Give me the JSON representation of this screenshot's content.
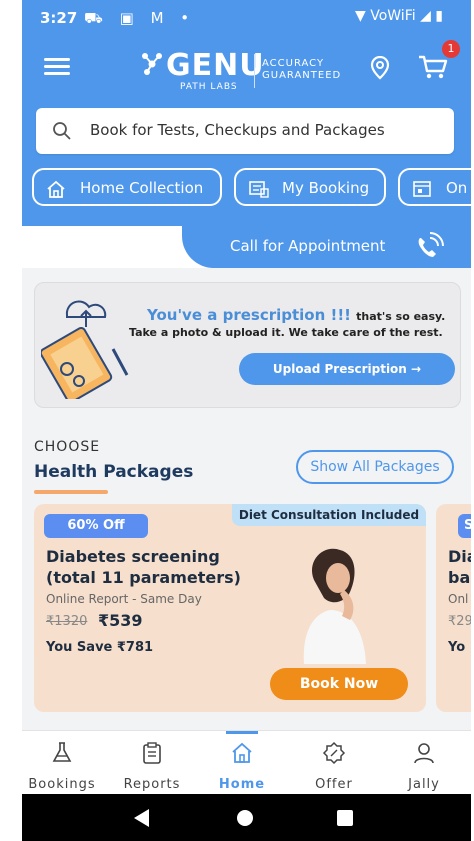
{
  "status_bar": {
    "time": "3:27",
    "left_icons": "⛟ ▣ M •",
    "right_icons": "▼ VoWiFi ◢ ▮"
  },
  "header": {
    "logo_text": "GENU",
    "logo_sub": "PATH LABS",
    "tagline_1": "ACCURACY",
    "tagline_2": "GUARANTEED",
    "cart_count": "1"
  },
  "search": {
    "placeholder": "Book for Tests, Checkups and Packages"
  },
  "chips": [
    {
      "label": "Home Collection",
      "icon": "home-icon"
    },
    {
      "label": "My Booking",
      "icon": "booking-icon"
    },
    {
      "label": "On",
      "icon": "calendar-icon"
    }
  ],
  "call": {
    "label": "Call for Appointment",
    "icon": "phone-ring-icon"
  },
  "prescription": {
    "headline": "You've a prescription !!!",
    "headline_suffix": "that's so easy.",
    "subline": "Take a photo & upload it. We take care of the rest.",
    "button": "Upload Prescription →"
  },
  "packages": {
    "choose": "CHOOSE",
    "title": "Health Packages",
    "show_all": "Show All Packages",
    "cards": [
      {
        "discount": "60% Off",
        "tag": "Diet Consultation Included",
        "title_line1": "Diabetes screening",
        "title_line2": "(total 11 parameters)",
        "report": "Online Report - Same Day",
        "old_price": "₹1320",
        "new_price": "₹539",
        "save": "You Save ₹781",
        "button": "Book Now"
      },
      {
        "discount": "S",
        "title_line1": "Dia",
        "title_line2": "ba",
        "report": "Onl",
        "old_price": "₹29",
        "save": "Yo"
      }
    ]
  },
  "bottom_nav": [
    {
      "label": "Bookings",
      "icon": "flask-icon"
    },
    {
      "label": "Reports",
      "icon": "clipboard-icon"
    },
    {
      "label": "Home",
      "icon": "home-icon",
      "active": true
    },
    {
      "label": "Offer",
      "icon": "offer-icon"
    },
    {
      "label": "Jally",
      "icon": "user-icon"
    }
  ],
  "colors": {
    "primary": "#4f97ea",
    "accent": "#f08c18",
    "card_bg": "#f6dfcd",
    "badge_red": "#e53935"
  }
}
